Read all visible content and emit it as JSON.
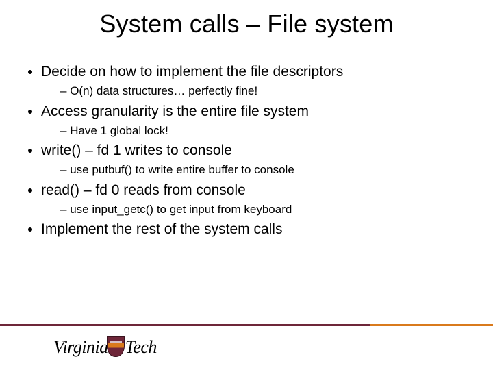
{
  "title": "System calls – File system",
  "bullets": {
    "b1": "Decide on how to implement the file descriptors",
    "s1": "O(n) data structures… perfectly fine!",
    "b2": "Access granularity is the entire file system",
    "s2": "Have 1 global lock!",
    "b3": "write() – fd 1 writes to console",
    "s3": "use putbuf() to write entire buffer to console",
    "b4": "read() – fd 0 reads from console",
    "s4": "use input_getc() to get input from keyboard",
    "b5": "Implement the rest of the system calls"
  },
  "logo": {
    "part1": "Virginia",
    "part2": "Tech"
  }
}
